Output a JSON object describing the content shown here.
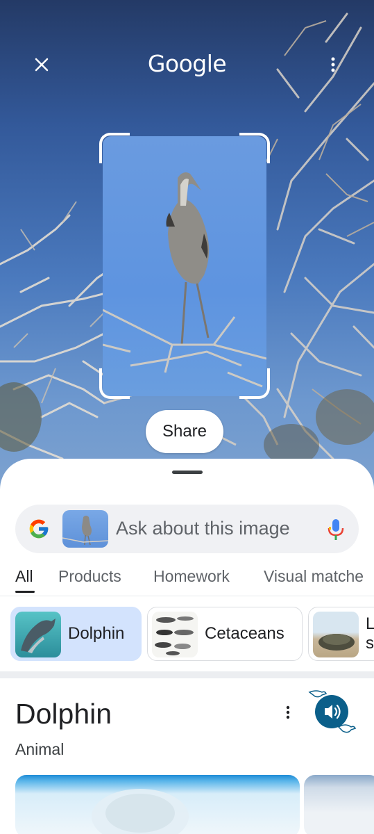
{
  "header": {
    "logo_text": "Google",
    "close_icon": "close-icon",
    "menu_icon": "more-vert-icon"
  },
  "selection": {
    "share_label": "Share"
  },
  "search": {
    "placeholder": "Ask about this image",
    "left_icon": "google-g-icon",
    "right_icon": "mic-icon"
  },
  "tabs": [
    {
      "label": "All",
      "active": true
    },
    {
      "label": "Products",
      "active": false
    },
    {
      "label": "Homework",
      "active": false
    },
    {
      "label": "Visual matche",
      "active": false
    }
  ],
  "chips": [
    {
      "label": "Dolphin",
      "selected": true
    },
    {
      "label": "Cetaceans",
      "selected": false
    },
    {
      "label": "L\ns",
      "selected": false
    }
  ],
  "knowledge_panel": {
    "title": "Dolphin",
    "subtitle": "Animal",
    "more_icon": "more-vert-icon",
    "audio_icon": "volume-icon"
  },
  "colors": {
    "accent_blue": "#1a73e8",
    "chip_selected": "#d3e3fd",
    "audio_button": "#0b5f8a"
  }
}
